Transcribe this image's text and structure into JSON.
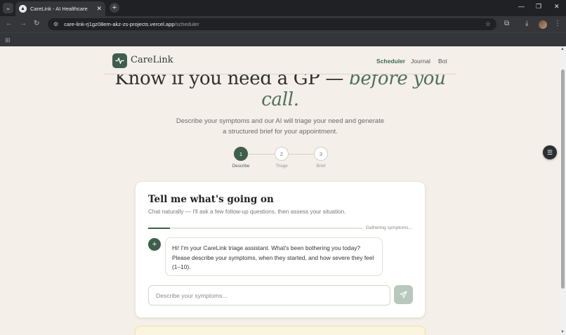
{
  "browser": {
    "tab_title": "CareLink - AI Healthcare",
    "new_tab": "+",
    "url_host": "care-link-rj1gz08em-akz-zs-projects.vercel.app",
    "url_path": "/scheduler",
    "window_controls": {
      "minimize": "—",
      "restore": "❐",
      "close": "✕"
    }
  },
  "site": {
    "brand": "CareLink",
    "nav": [
      "Scheduler",
      "Journal",
      "Bot"
    ],
    "active_nav": "Scheduler"
  },
  "hero": {
    "title_main": "Know if you need a GP — ",
    "title_accent": "before you call.",
    "subtitle": "Describe your symptoms and our AI will triage your need and generate a structured brief for your appointment."
  },
  "stepper": {
    "steps": [
      {
        "number": "1",
        "label": "Describe"
      },
      {
        "number": "2",
        "label": "Triage"
      },
      {
        "number": "3",
        "label": "Brief"
      }
    ],
    "active_step": 1
  },
  "chat_card": {
    "title": "Tell me what's going on",
    "subtitle": "Chat naturally — I'll ask a few follow-up questions, then assess your situation.",
    "progress_label": "Gathering symptoms...",
    "progress_fraction": 0.1,
    "bot_message": "Hi! I'm your CareLink triage assistant. What's been bothering you today? Please describe your symptoms, when they started, and how severe they feel (1–10).",
    "input_placeholder": "Describe your symptoms...",
    "input_value": ""
  },
  "colors": {
    "brand_green": "#3f5e4c",
    "page_bg": "#f4efe8",
    "send_disabled": "#b9c8bd"
  }
}
